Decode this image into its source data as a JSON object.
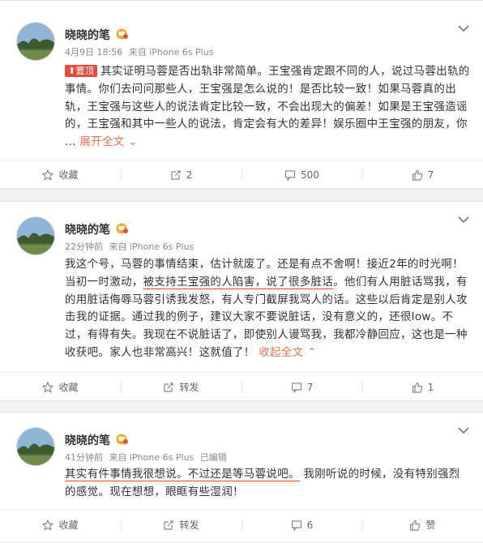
{
  "posts": [
    {
      "author": "晓晓的笔",
      "time": "4月9日 18:56",
      "source": "来自 iPhone 6s Plus",
      "pin_label": "置顶",
      "text": "其实证明马蓉是否出轨非常简单。王宝强肯定跟不同的人，说过马蓉出轨的事情。你们去问问那些人，王宝强是怎么说的！是否比较一致！如果马蓉真的出轨，王宝强与这些人的说法肯定比较一致，不会出现大的偏差！如果是王宝强造谣的，王宝强和其中一些人的说法，肯定会有大的差异！娱乐圈中王宝强的朋友，你 ...",
      "expand_label": "展开全文",
      "actions": {
        "favorite": "收藏",
        "repost": "2",
        "comment": "500",
        "like": "7"
      }
    },
    {
      "author": "晓晓的笔",
      "time": "22分钟前",
      "source": "来自 iPhone 6s Plus",
      "text_a": "我这个号，马蓉的事情结束，估计就废了。还是有点不舍啊！接近2年的时光啊！当初一时激动，",
      "text_hl": "被支持王宝强的人陷害，说了很多脏话",
      "text_b": "。他们有人用脏话骂我，有的用脏话侮辱马蓉引诱我发怒，有人专门截屏我骂人的话。这些以后肯定是别人攻击我的证据。通过我的例子，建议大家不要说脏话，没有意义的，还很low。不过，有得有失。我现在不说脏话了，即使别人谩骂我，我都冷静回应，这也是一种收获吧。家人也非常高兴！这就值了！",
      "collapse_label": "收起全文",
      "actions": {
        "favorite": "收藏",
        "repost": "转发",
        "comment": "7",
        "like": "1"
      }
    },
    {
      "author": "晓晓的笔",
      "time": "41分钟前",
      "source": "来自 iPhone 6s Plus",
      "edited": "已编辑",
      "text_hl": "其实有件事情我很想说。不过还是等马蓉说吧。",
      "text_b": "我刚听说的时候，没有特别强烈的感觉。现在想想，眼眶有些湿润！",
      "actions": {
        "favorite": "收藏",
        "repost": "转发",
        "comment": "6",
        "like": "赞"
      }
    }
  ],
  "colors": {
    "link": "#eb7350",
    "pin": "#e74c3c",
    "underline": "#e24a2b",
    "background": "#f2f2f5"
  }
}
